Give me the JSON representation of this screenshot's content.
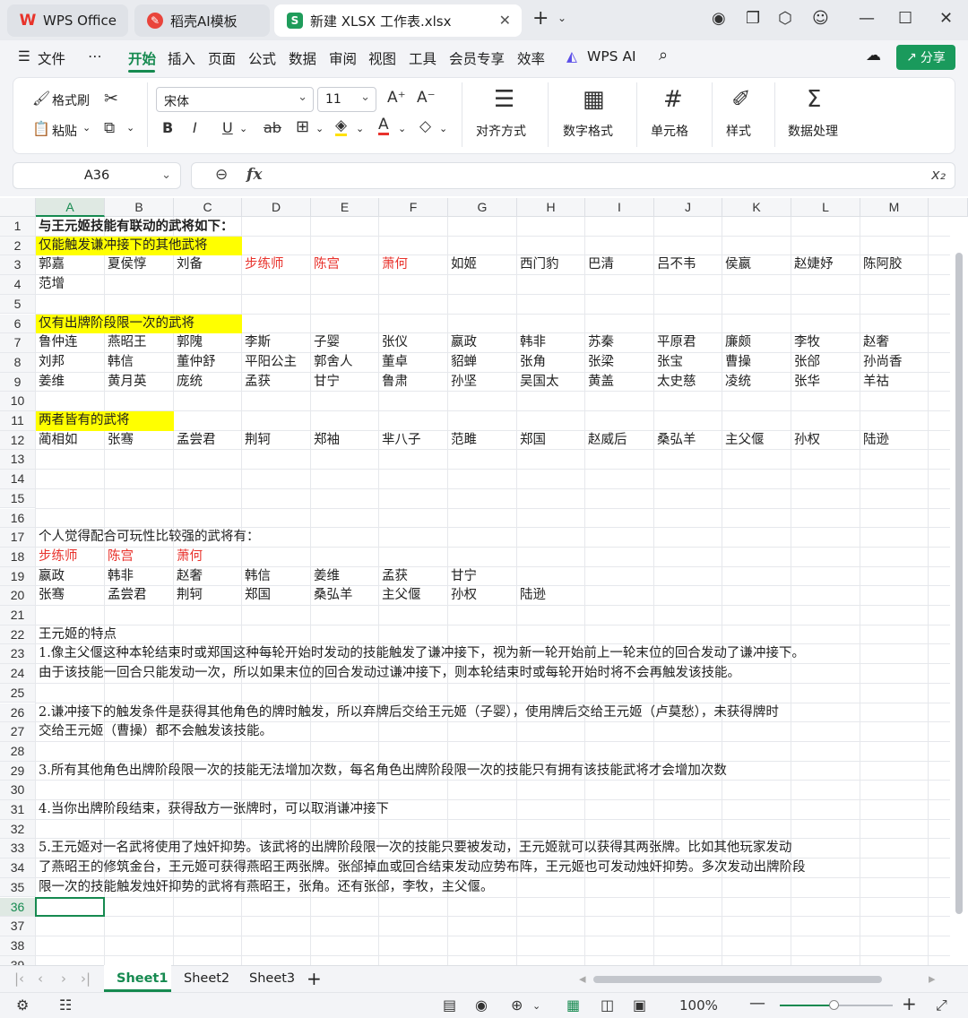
{
  "titlebar": {
    "tabs": [
      {
        "label": "WPS Office",
        "icon": "wps-logo-icon"
      },
      {
        "label": "稻壳AI模板",
        "icon": "docer-icon"
      },
      {
        "label": "新建 XLSX 工作表.xlsx",
        "icon": "spreadsheet-icon",
        "icon_text": "S"
      }
    ],
    "new_tab": "+",
    "window_controls": [
      "minimize",
      "maximize",
      "close"
    ]
  },
  "menubar": {
    "file": "文件",
    "items": [
      "开始",
      "插入",
      "页面",
      "公式",
      "数据",
      "审阅",
      "视图",
      "工具",
      "会员专享",
      "效率"
    ],
    "ai": "WPS AI",
    "share": "分享"
  },
  "ribbon": {
    "format_painter": "格式刷",
    "paste": "粘贴",
    "font_name": "宋体",
    "font_size": "11",
    "align": "对齐方式",
    "number_format": "数字格式",
    "cell": "单元格",
    "style": "样式",
    "data_processing": "数据处理"
  },
  "formula_bar": {
    "cell_ref": "A36",
    "fx": "fx",
    "value": ""
  },
  "columns": [
    "A",
    "B",
    "C",
    "D",
    "E",
    "F",
    "G",
    "H",
    "I",
    "J",
    "K",
    "L",
    "M"
  ],
  "rows": [
    "1",
    "2",
    "3",
    "4",
    "5",
    "6",
    "7",
    "8",
    "9",
    "10",
    "11",
    "12",
    "13",
    "14",
    "15",
    "16",
    "17",
    "18",
    "19",
    "20",
    "21",
    "22",
    "23",
    "24",
    "25",
    "26",
    "27",
    "28",
    "29",
    "30",
    "31",
    "32",
    "33",
    "34",
    "35",
    "36",
    "37",
    "38",
    "39"
  ],
  "cells": {
    "r1": "与王元姬技能有联动的武将如下：",
    "r2": "仅能触发谦冲接下的其他武将",
    "r3": [
      "郭嘉",
      "夏侯惇",
      "刘备",
      "步练师",
      "陈宫",
      "萧何",
      "如姬",
      "西门豹",
      "巴清",
      "吕不韦",
      "侯嬴",
      "赵婕妤",
      "陈阿胶"
    ],
    "r4": [
      "范增"
    ],
    "r6": "仅有出牌阶段限一次的武将",
    "r7": [
      "鲁仲连",
      "燕昭王",
      "郭隗",
      "李斯",
      "子婴",
      "张仪",
      "嬴政",
      "韩非",
      "苏秦",
      "平原君",
      "廉颇",
      "李牧",
      "赵奢"
    ],
    "r8": [
      "刘邦",
      "韩信",
      "董仲舒",
      "平阳公主",
      "郭舍人",
      "董卓",
      "貂蝉",
      "张角",
      "张梁",
      "张宝",
      "曹操",
      "张郃",
      "孙尚香"
    ],
    "r9": [
      "姜维",
      "黄月英",
      "庞统",
      "孟获",
      "甘宁",
      "鲁肃",
      "孙坚",
      "吴国太",
      "黄盖",
      "太史慈",
      "凌统",
      "张华",
      "羊祜"
    ],
    "r11": "两者皆有的武将",
    "r12": [
      "蔺相如",
      "张骞",
      "孟尝君",
      "荆轲",
      "郑袖",
      "芈八子",
      "范雎",
      "郑国",
      "赵威后",
      "桑弘羊",
      "主父偃",
      "孙权",
      "陆逊"
    ],
    "r17": "个人觉得配合可玩性比较强的武将有：",
    "r18": [
      "步练师",
      "陈宫",
      "萧何"
    ],
    "r19": [
      "嬴政",
      "韩非",
      "赵奢",
      "韩信",
      "姜维",
      "孟获",
      "甘宁"
    ],
    "r20": [
      "张骞",
      "孟尝君",
      "荆轲",
      "郑国",
      "桑弘羊",
      "主父偃",
      "孙权",
      "陆逊"
    ],
    "r22": "王元姬的特点",
    "r23": "1.像主父偃这种本轮结束时或郑国这种每轮开始时发动的技能触发了谦冲接下，视为新一轮开始前上一轮末位的回合发动了谦冲接下。",
    "r24": "由于该技能一回合只能发动一次，所以如果末位的回合发动过谦冲接下，则本轮结束时或每轮开始时将不会再触发该技能。",
    "r26": "2.谦冲接下的触发条件是获得其他角色的牌时触发，所以弃牌后交给王元姬（子婴），使用牌后交给王元姬（卢莫愁），未获得牌时",
    "r27": "交给王元姬（曹操）都不会触发该技能。",
    "r29": "3.所有其他角色出牌阶段限一次的技能无法增加次数，每名角色出牌阶段限一次的技能只有拥有该技能武将才会增加次数",
    "r31": "4.当你出牌阶段结束，获得敌方一张牌时，可以取消谦冲接下",
    "r33": "5.王元姬对一名武将使用了烛奸抑势。该武将的出牌阶段限一次的技能只要被发动，王元姬就可以获得其两张牌。比如其他玩家发动",
    "r34": "了燕昭王的修筑金台，王元姬可获得燕昭王两张牌。张郃掉血或回合结束发动应势布阵，王元姬也可发动烛奸抑势。多次发动出牌阶段",
    "r35": "限一次的技能触发烛奸抑势的武将有燕昭王，张角。还有张郃，李牧，主父偃。"
  },
  "red_cells": [
    "r3.3",
    "r3.4",
    "r3.5",
    "r18.0",
    "r18.1",
    "r18.2"
  ],
  "sheets": [
    "Sheet1",
    "Sheet2",
    "Sheet3"
  ],
  "active_sheet": "Sheet1",
  "statusbar": {
    "zoom": "100%"
  },
  "colors": {
    "accent": "#168a50",
    "highlight": "#ffff00",
    "red_text": "#e8322c"
  }
}
